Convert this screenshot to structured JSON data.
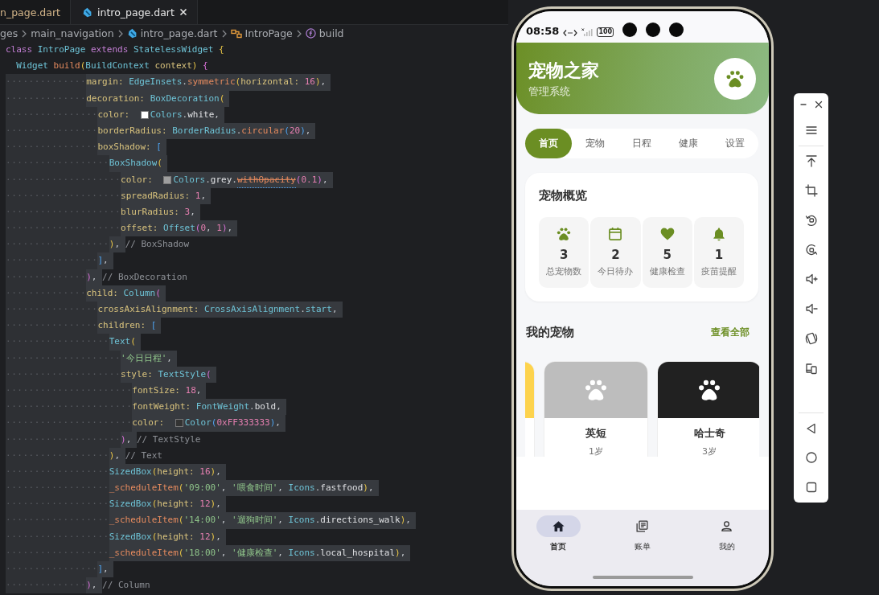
{
  "editor": {
    "tabs": [
      {
        "label": "n_page.dart",
        "selected": false
      },
      {
        "label": "intro_page.dart",
        "selected": true
      }
    ],
    "breadcrumb": [
      {
        "kind": "folder",
        "text": "ges"
      },
      {
        "kind": "folder",
        "text": "main_navigation"
      },
      {
        "kind": "file",
        "text": "intro_page.dart"
      },
      {
        "kind": "class",
        "text": "IntroPage"
      },
      {
        "kind": "method",
        "text": "build"
      }
    ],
    "lines": [
      {
        "selected": false,
        "tokens": [
          {
            "kind": "kw",
            "text": "class "
          },
          {
            "kind": "type",
            "text": "IntroPage "
          },
          {
            "kind": "kw",
            "text": "extends "
          },
          {
            "kind": "type",
            "text": "StatelessWidget "
          },
          {
            "kind": "b1",
            "text": "{"
          }
        ]
      },
      {
        "selected": false,
        "tokens": [
          {
            "kind": "type",
            "text": "  Widget "
          },
          {
            "kind": "fn",
            "text": "build"
          },
          {
            "kind": "b1",
            "text": "("
          },
          {
            "kind": "type",
            "text": "BuildContext "
          },
          {
            "kind": "prop",
            "text": "context"
          },
          {
            "kind": "b1",
            "text": ") "
          },
          {
            "kind": "b2",
            "text": "{"
          }
        ]
      },
      {
        "indent": "··············",
        "selected": true,
        "tokens": [
          {
            "kind": "prop",
            "text": "margin: "
          },
          {
            "kind": "type",
            "text": "EdgeInsets"
          },
          {
            "kind": "pun",
            "text": "."
          },
          {
            "kind": "fn",
            "text": "symmetric"
          },
          {
            "kind": "b1",
            "text": "("
          },
          {
            "kind": "prop",
            "text": "horizontal: "
          },
          {
            "kind": "num",
            "text": "16"
          },
          {
            "kind": "b1",
            "text": ")"
          },
          {
            "kind": "pun",
            "text": ","
          }
        ]
      },
      {
        "indent": "··············",
        "selected": true,
        "tokens": [
          {
            "kind": "prop",
            "text": "decoration: "
          },
          {
            "kind": "type",
            "text": "BoxDecoration"
          },
          {
            "kind": "b1",
            "text": "("
          }
        ]
      },
      {
        "indent": "················",
        "selected": true,
        "tokens": [
          {
            "kind": "prop",
            "text": "color: "
          },
          {
            "kind": "swatch",
            "color": "#ffffff"
          },
          {
            "kind": "type",
            "text": "Colors"
          },
          {
            "kind": "pun",
            "text": "."
          },
          {
            "kind": "id",
            "text": "white"
          },
          {
            "kind": "pun",
            "text": ","
          }
        ]
      },
      {
        "indent": "················",
        "selected": true,
        "tokens": [
          {
            "kind": "prop",
            "text": "borderRadius: "
          },
          {
            "kind": "type",
            "text": "BorderRadius"
          },
          {
            "kind": "pun",
            "text": "."
          },
          {
            "kind": "fn",
            "text": "circular"
          },
          {
            "kind": "b3",
            "text": "("
          },
          {
            "kind": "num",
            "text": "20"
          },
          {
            "kind": "b3",
            "text": ")"
          },
          {
            "kind": "pun",
            "text": ","
          }
        ]
      },
      {
        "indent": "················",
        "selected": true,
        "tokens": [
          {
            "kind": "prop",
            "text": "boxShadow: "
          },
          {
            "kind": "b3",
            "text": "["
          }
        ]
      },
      {
        "indent": "··················",
        "selected": true,
        "tokens": [
          {
            "kind": "type",
            "text": "BoxShadow"
          },
          {
            "kind": "b1",
            "text": "("
          }
        ]
      },
      {
        "indent": "····················",
        "selected": true,
        "tokens": [
          {
            "kind": "prop",
            "text": "color: "
          },
          {
            "kind": "swatch",
            "color": "#9e9e9e"
          },
          {
            "kind": "type",
            "text": "Colors"
          },
          {
            "kind": "pun",
            "text": "."
          },
          {
            "kind": "id",
            "text": "grey"
          },
          {
            "kind": "pun",
            "text": "."
          },
          {
            "kind": "dep",
            "text": "withOpacity"
          },
          {
            "kind": "b2",
            "text": "("
          },
          {
            "kind": "num",
            "text": "0.1"
          },
          {
            "kind": "b2",
            "text": ")"
          },
          {
            "kind": "pun",
            "text": ","
          }
        ]
      },
      {
        "indent": "····················",
        "selected": true,
        "tokens": [
          {
            "kind": "prop",
            "text": "spreadRadius: "
          },
          {
            "kind": "num",
            "text": "1"
          },
          {
            "kind": "pun",
            "text": ","
          }
        ]
      },
      {
        "indent": "····················",
        "selected": true,
        "tokens": [
          {
            "kind": "prop",
            "text": "blurRadius: "
          },
          {
            "kind": "num",
            "text": "3"
          },
          {
            "kind": "pun",
            "text": ","
          }
        ]
      },
      {
        "indent": "····················",
        "selected": true,
        "tokens": [
          {
            "kind": "prop",
            "text": "offset: "
          },
          {
            "kind": "type",
            "text": "Offset"
          },
          {
            "kind": "b2",
            "text": "("
          },
          {
            "kind": "num",
            "text": "0"
          },
          {
            "kind": "pun",
            "text": ", "
          },
          {
            "kind": "num",
            "text": "1"
          },
          {
            "kind": "b2",
            "text": ")"
          },
          {
            "kind": "pun",
            "text": ","
          }
        ]
      },
      {
        "indent": "··················",
        "selected": true,
        "tokens": [
          {
            "kind": "b1",
            "text": ")"
          },
          {
            "kind": "pun",
            "text": ", "
          },
          {
            "kind": "com",
            "text": "// BoxShadow"
          }
        ]
      },
      {
        "indent": "················",
        "selected": true,
        "tokens": [
          {
            "kind": "b3",
            "text": "]"
          },
          {
            "kind": "pun",
            "text": ","
          }
        ]
      },
      {
        "indent": "··············",
        "selected": true,
        "tokens": [
          {
            "kind": "b2",
            "text": ")"
          },
          {
            "kind": "pun",
            "text": ", "
          },
          {
            "kind": "com",
            "text": "// BoxDecoration"
          }
        ]
      },
      {
        "indent": "··············",
        "selected": true,
        "tokens": [
          {
            "kind": "prop",
            "text": "child: "
          },
          {
            "kind": "type",
            "text": "Column"
          },
          {
            "kind": "b2",
            "text": "("
          }
        ]
      },
      {
        "indent": "················",
        "selected": true,
        "tokens": [
          {
            "kind": "prop",
            "text": "crossAxisAlignment: "
          },
          {
            "kind": "type",
            "text": "CrossAxisAlignment"
          },
          {
            "kind": "pun",
            "text": "."
          },
          {
            "kind": "type",
            "text": "start"
          },
          {
            "kind": "pun",
            "text": ","
          }
        ]
      },
      {
        "indent": "················",
        "selected": true,
        "tokens": [
          {
            "kind": "prop",
            "text": "children: "
          },
          {
            "kind": "b3",
            "text": "["
          }
        ]
      },
      {
        "indent": "··················",
        "selected": true,
        "tokens": [
          {
            "kind": "type",
            "text": "Text"
          },
          {
            "kind": "b1",
            "text": "("
          }
        ]
      },
      {
        "indent": "····················",
        "selected": true,
        "tokens": [
          {
            "kind": "str",
            "text": "'今日日程'"
          },
          {
            "kind": "pun",
            "text": ","
          }
        ]
      },
      {
        "indent": "····················",
        "selected": true,
        "tokens": [
          {
            "kind": "prop",
            "text": "style: "
          },
          {
            "kind": "type",
            "text": "TextStyle"
          },
          {
            "kind": "b2",
            "text": "("
          }
        ]
      },
      {
        "indent": "······················",
        "selected": true,
        "tokens": [
          {
            "kind": "prop",
            "text": "fontSize: "
          },
          {
            "kind": "num",
            "text": "18"
          },
          {
            "kind": "pun",
            "text": ","
          }
        ]
      },
      {
        "indent": "······················",
        "selected": true,
        "tokens": [
          {
            "kind": "prop",
            "text": "fontWeight: "
          },
          {
            "kind": "type",
            "text": "FontWeight"
          },
          {
            "kind": "pun",
            "text": "."
          },
          {
            "kind": "id",
            "text": "bold"
          },
          {
            "kind": "pun",
            "text": ","
          }
        ]
      },
      {
        "indent": "······················",
        "selected": true,
        "tokens": [
          {
            "kind": "prop",
            "text": "color: "
          },
          {
            "kind": "swatch",
            "color": "#333333"
          },
          {
            "kind": "type",
            "text": "Color"
          },
          {
            "kind": "b3",
            "text": "("
          },
          {
            "kind": "num",
            "text": "0xFF333333"
          },
          {
            "kind": "b3",
            "text": ")"
          },
          {
            "kind": "pun",
            "text": ","
          }
        ]
      },
      {
        "indent": "····················",
        "selected": true,
        "tokens": [
          {
            "kind": "b2",
            "text": ")"
          },
          {
            "kind": "pun",
            "text": ", "
          },
          {
            "kind": "com",
            "text": "// TextStyle"
          }
        ]
      },
      {
        "indent": "··················",
        "selected": true,
        "tokens": [
          {
            "kind": "b1",
            "text": ")"
          },
          {
            "kind": "pun",
            "text": ", "
          },
          {
            "kind": "com",
            "text": "// Text"
          }
        ]
      },
      {
        "indent": "··················",
        "selected": true,
        "tokens": [
          {
            "kind": "type",
            "text": "SizedBox"
          },
          {
            "kind": "b1",
            "text": "("
          },
          {
            "kind": "prop",
            "text": "height: "
          },
          {
            "kind": "num",
            "text": "16"
          },
          {
            "kind": "b1",
            "text": ")"
          },
          {
            "kind": "pun",
            "text": ","
          }
        ]
      },
      {
        "indent": "··················",
        "selected": true,
        "tokens": [
          {
            "kind": "fn",
            "text": "_scheduleItem"
          },
          {
            "kind": "b1",
            "text": "("
          },
          {
            "kind": "str",
            "text": "'09:00'"
          },
          {
            "kind": "pun",
            "text": ", "
          },
          {
            "kind": "str",
            "text": "'喂食时间'"
          },
          {
            "kind": "pun",
            "text": ", "
          },
          {
            "kind": "type",
            "text": "Icons"
          },
          {
            "kind": "pun",
            "text": "."
          },
          {
            "kind": "id",
            "text": "fastfood"
          },
          {
            "kind": "b1",
            "text": ")"
          },
          {
            "kind": "pun",
            "text": ","
          }
        ]
      },
      {
        "indent": "··················",
        "selected": true,
        "tokens": [
          {
            "kind": "type",
            "text": "SizedBox"
          },
          {
            "kind": "b1",
            "text": "("
          },
          {
            "kind": "prop",
            "text": "height: "
          },
          {
            "kind": "num",
            "text": "12"
          },
          {
            "kind": "b1",
            "text": ")"
          },
          {
            "kind": "pun",
            "text": ","
          }
        ]
      },
      {
        "indent": "··················",
        "selected": true,
        "tokens": [
          {
            "kind": "fn",
            "text": "_scheduleItem"
          },
          {
            "kind": "b1",
            "text": "("
          },
          {
            "kind": "str",
            "text": "'14:00'"
          },
          {
            "kind": "pun",
            "text": ", "
          },
          {
            "kind": "str",
            "text": "'遛狗时间'"
          },
          {
            "kind": "pun",
            "text": ", "
          },
          {
            "kind": "type",
            "text": "Icons"
          },
          {
            "kind": "pun",
            "text": "."
          },
          {
            "kind": "id",
            "text": "directions_walk"
          },
          {
            "kind": "b1",
            "text": ")"
          },
          {
            "kind": "pun",
            "text": ","
          }
        ]
      },
      {
        "indent": "··················",
        "selected": true,
        "tokens": [
          {
            "kind": "type",
            "text": "SizedBox"
          },
          {
            "kind": "b1",
            "text": "("
          },
          {
            "kind": "prop",
            "text": "height: "
          },
          {
            "kind": "num",
            "text": "12"
          },
          {
            "kind": "b1",
            "text": ")"
          },
          {
            "kind": "pun",
            "text": ","
          }
        ]
      },
      {
        "indent": "··················",
        "selected": true,
        "tokens": [
          {
            "kind": "fn",
            "text": "_scheduleItem"
          },
          {
            "kind": "b1",
            "text": "("
          },
          {
            "kind": "str",
            "text": "'18:00'"
          },
          {
            "kind": "pun",
            "text": ", "
          },
          {
            "kind": "str",
            "text": "'健康检查'"
          },
          {
            "kind": "pun",
            "text": ", "
          },
          {
            "kind": "type",
            "text": "Icons"
          },
          {
            "kind": "pun",
            "text": "."
          },
          {
            "kind": "id",
            "text": "local_hospital"
          },
          {
            "kind": "b1",
            "text": ")"
          },
          {
            "kind": "pun",
            "text": ","
          }
        ]
      },
      {
        "indent": "················",
        "selected": true,
        "tokens": [
          {
            "kind": "b3",
            "text": "]"
          },
          {
            "kind": "pun",
            "text": ","
          }
        ]
      },
      {
        "indent": "··············",
        "selected": true,
        "tokens": [
          {
            "kind": "b2",
            "text": ")"
          },
          {
            "kind": "pun",
            "text": ", "
          },
          {
            "kind": "com",
            "text": "// Column"
          }
        ]
      }
    ]
  },
  "phone": {
    "status_bar": {
      "time": "08:58",
      "battery": "100"
    },
    "header": {
      "title": "宠物之家",
      "subtitle": "管理系统"
    },
    "tabs": [
      {
        "label": "首页",
        "selected": true
      },
      {
        "label": "宠物",
        "selected": false
      },
      {
        "label": "日程",
        "selected": false
      },
      {
        "label": "健康",
        "selected": false
      },
      {
        "label": "设置",
        "selected": false
      }
    ],
    "overview": {
      "title": "宠物概览",
      "stats": [
        {
          "value": "3",
          "label": "总宠物数"
        },
        {
          "value": "2",
          "label": "今日待办"
        },
        {
          "value": "5",
          "label": "健康检查"
        },
        {
          "value": "1",
          "label": "疫苗提醒"
        }
      ]
    },
    "pets_section": {
      "title": "我的宠物",
      "link": "查看全部",
      "pets": [
        {
          "color": "#fdd34d"
        },
        {
          "name": "英短",
          "age": "1岁",
          "color": "#bdbdbd"
        },
        {
          "name": "哈士奇",
          "age": "3岁",
          "color": "#212121"
        }
      ]
    },
    "bottom_nav": [
      {
        "label": "首页",
        "selected": true
      },
      {
        "label": "账单",
        "selected": false
      },
      {
        "label": "我的",
        "selected": false
      }
    ]
  }
}
